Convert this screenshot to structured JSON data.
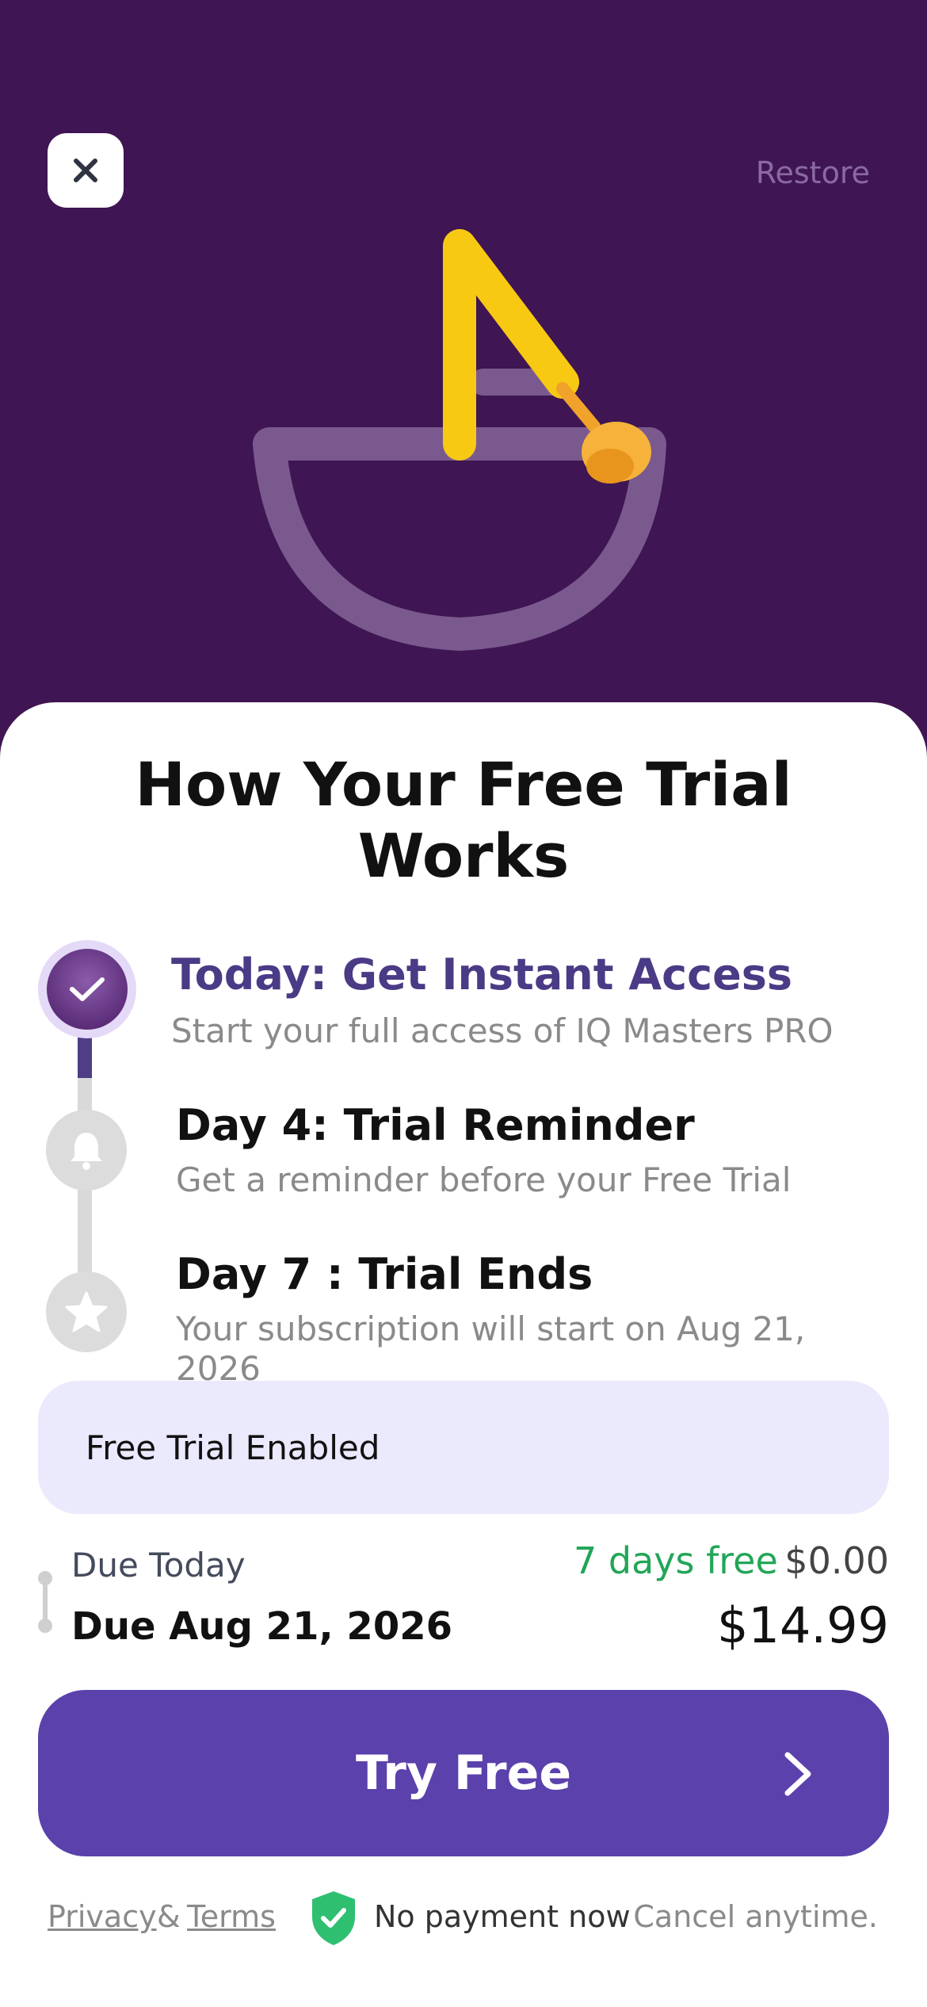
{
  "header": {
    "restore_label": "Restore"
  },
  "title": "How Your Free Trial Works",
  "steps": [
    {
      "title": "Today: Get Instant Access",
      "description": "Start your full access of IQ Masters PRO",
      "state": "done"
    },
    {
      "title": "Day 4: Trial Reminder",
      "description": "Get a reminder before your Free Trial",
      "state": "upcoming"
    },
    {
      "title": "Day 7 : Trial Ends",
      "description": "Your subscription will start on Aug 21, 2026",
      "state": "upcoming"
    }
  ],
  "trial_toggle": {
    "label": "Free Trial Enabled"
  },
  "due": {
    "today_label": "Due Today",
    "today_badge": "7 days free",
    "today_price": "$0.00",
    "later_label": "Due Aug 21, 2026",
    "later_price": "$14.99"
  },
  "cta": {
    "label": "Try Free"
  },
  "footer": {
    "privacy": "Privacy",
    "amp": "&",
    "terms": "Terms",
    "no_payment": "No payment now",
    "cancel": "Cancel anytime."
  },
  "colors": {
    "hero_bg": "#3f1553",
    "accent": "#5b41ab",
    "step_active_text": "#4b3a85",
    "free_green": "#22a657",
    "toggle_bg": "#ebe9fc"
  },
  "icons": {
    "close": "close-icon",
    "check": "check-icon",
    "bell": "bell-icon",
    "star": "star-icon",
    "chevron": "chevron-right-icon",
    "shield": "shield-check-icon",
    "hero": "letter-tracing-illustration"
  }
}
